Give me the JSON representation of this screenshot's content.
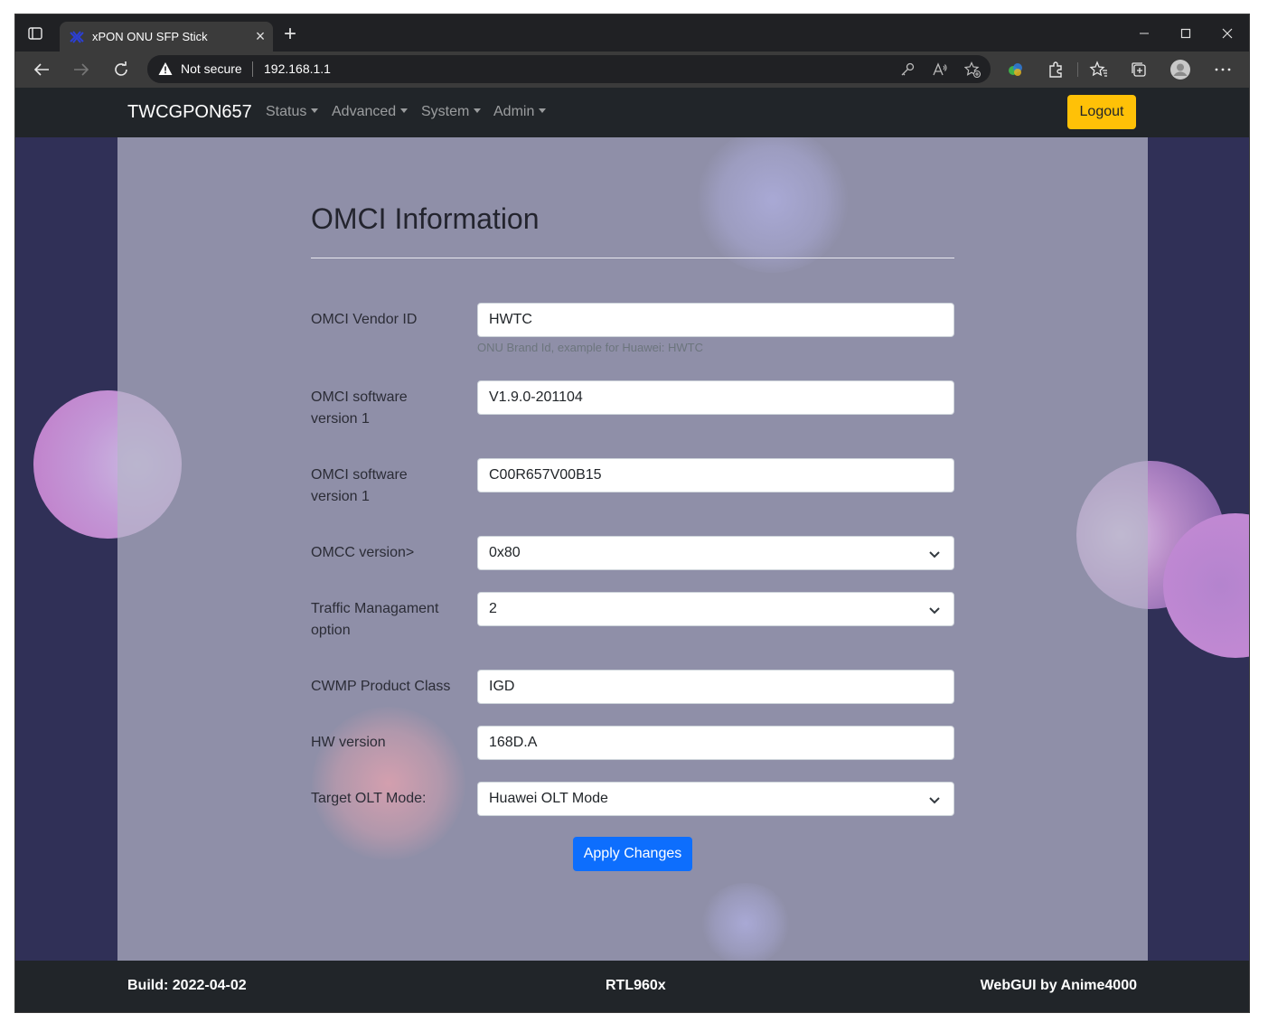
{
  "browser": {
    "tab_title": "xPON ONU SFP Stick",
    "security_label": "Not secure",
    "url": "192.168.1.1",
    "new_tab_label": "+",
    "close_tab_label": "×"
  },
  "navbar": {
    "brand": "TWCGPON657",
    "menus": [
      {
        "label": "Status"
      },
      {
        "label": "Advanced"
      },
      {
        "label": "System"
      },
      {
        "label": "Admin"
      }
    ],
    "logout_label": "Logout"
  },
  "page": {
    "title": "OMCI Information",
    "fields": [
      {
        "label": "OMCI Vendor ID",
        "value": "HWTC",
        "help": "ONU Brand Id, example for Huawei: HWTC"
      },
      {
        "label": "OMCI software version 1",
        "value": "V1.9.0-201104"
      },
      {
        "label": "OMCI software version 1",
        "value": "C00R657V00B15"
      },
      {
        "label": "OMCC version>",
        "value": "0x80"
      },
      {
        "label": "Traffic Managament option",
        "value": "2"
      },
      {
        "label": "CWMP Product Class",
        "value": "IGD"
      },
      {
        "label": "HW version",
        "value": "168D.A"
      },
      {
        "label": "Target OLT Mode:",
        "value": "Huawei OLT Mode"
      }
    ],
    "apply_label": "Apply Changes"
  },
  "footer": {
    "build": "Build: 2022-04-02",
    "chip": "RTL960x",
    "credit": "WebGUI by Anime4000"
  },
  "colors": {
    "navbar_bg": "#212529",
    "page_bg": "#303057",
    "logout_bg": "#ffc107",
    "apply_bg": "#0d6efd"
  },
  "icons": {
    "favicon": "xpon-logo-icon",
    "security": "warning-triangle-icon",
    "select": "chevron-down-icon"
  }
}
